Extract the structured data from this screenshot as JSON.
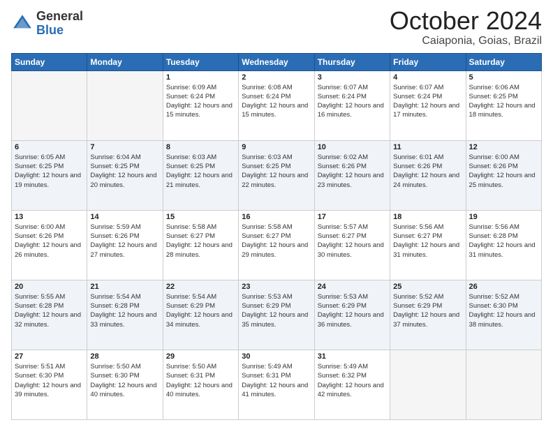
{
  "header": {
    "logo_general": "General",
    "logo_blue": "Blue",
    "month_title": "October 2024",
    "location": "Caiaponia, Goias, Brazil"
  },
  "weekdays": [
    "Sunday",
    "Monday",
    "Tuesday",
    "Wednesday",
    "Thursday",
    "Friday",
    "Saturday"
  ],
  "weeks": [
    [
      {
        "day": "",
        "info": ""
      },
      {
        "day": "",
        "info": ""
      },
      {
        "day": "1",
        "info": "Sunrise: 6:09 AM\nSunset: 6:24 PM\nDaylight: 12 hours and 15 minutes."
      },
      {
        "day": "2",
        "info": "Sunrise: 6:08 AM\nSunset: 6:24 PM\nDaylight: 12 hours and 15 minutes."
      },
      {
        "day": "3",
        "info": "Sunrise: 6:07 AM\nSunset: 6:24 PM\nDaylight: 12 hours and 16 minutes."
      },
      {
        "day": "4",
        "info": "Sunrise: 6:07 AM\nSunset: 6:24 PM\nDaylight: 12 hours and 17 minutes."
      },
      {
        "day": "5",
        "info": "Sunrise: 6:06 AM\nSunset: 6:25 PM\nDaylight: 12 hours and 18 minutes."
      }
    ],
    [
      {
        "day": "6",
        "info": "Sunrise: 6:05 AM\nSunset: 6:25 PM\nDaylight: 12 hours and 19 minutes."
      },
      {
        "day": "7",
        "info": "Sunrise: 6:04 AM\nSunset: 6:25 PM\nDaylight: 12 hours and 20 minutes."
      },
      {
        "day": "8",
        "info": "Sunrise: 6:03 AM\nSunset: 6:25 PM\nDaylight: 12 hours and 21 minutes."
      },
      {
        "day": "9",
        "info": "Sunrise: 6:03 AM\nSunset: 6:25 PM\nDaylight: 12 hours and 22 minutes."
      },
      {
        "day": "10",
        "info": "Sunrise: 6:02 AM\nSunset: 6:26 PM\nDaylight: 12 hours and 23 minutes."
      },
      {
        "day": "11",
        "info": "Sunrise: 6:01 AM\nSunset: 6:26 PM\nDaylight: 12 hours and 24 minutes."
      },
      {
        "day": "12",
        "info": "Sunrise: 6:00 AM\nSunset: 6:26 PM\nDaylight: 12 hours and 25 minutes."
      }
    ],
    [
      {
        "day": "13",
        "info": "Sunrise: 6:00 AM\nSunset: 6:26 PM\nDaylight: 12 hours and 26 minutes."
      },
      {
        "day": "14",
        "info": "Sunrise: 5:59 AM\nSunset: 6:26 PM\nDaylight: 12 hours and 27 minutes."
      },
      {
        "day": "15",
        "info": "Sunrise: 5:58 AM\nSunset: 6:27 PM\nDaylight: 12 hours and 28 minutes."
      },
      {
        "day": "16",
        "info": "Sunrise: 5:58 AM\nSunset: 6:27 PM\nDaylight: 12 hours and 29 minutes."
      },
      {
        "day": "17",
        "info": "Sunrise: 5:57 AM\nSunset: 6:27 PM\nDaylight: 12 hours and 30 minutes."
      },
      {
        "day": "18",
        "info": "Sunrise: 5:56 AM\nSunset: 6:27 PM\nDaylight: 12 hours and 31 minutes."
      },
      {
        "day": "19",
        "info": "Sunrise: 5:56 AM\nSunset: 6:28 PM\nDaylight: 12 hours and 31 minutes."
      }
    ],
    [
      {
        "day": "20",
        "info": "Sunrise: 5:55 AM\nSunset: 6:28 PM\nDaylight: 12 hours and 32 minutes."
      },
      {
        "day": "21",
        "info": "Sunrise: 5:54 AM\nSunset: 6:28 PM\nDaylight: 12 hours and 33 minutes."
      },
      {
        "day": "22",
        "info": "Sunrise: 5:54 AM\nSunset: 6:29 PM\nDaylight: 12 hours and 34 minutes."
      },
      {
        "day": "23",
        "info": "Sunrise: 5:53 AM\nSunset: 6:29 PM\nDaylight: 12 hours and 35 minutes."
      },
      {
        "day": "24",
        "info": "Sunrise: 5:53 AM\nSunset: 6:29 PM\nDaylight: 12 hours and 36 minutes."
      },
      {
        "day": "25",
        "info": "Sunrise: 5:52 AM\nSunset: 6:29 PM\nDaylight: 12 hours and 37 minutes."
      },
      {
        "day": "26",
        "info": "Sunrise: 5:52 AM\nSunset: 6:30 PM\nDaylight: 12 hours and 38 minutes."
      }
    ],
    [
      {
        "day": "27",
        "info": "Sunrise: 5:51 AM\nSunset: 6:30 PM\nDaylight: 12 hours and 39 minutes."
      },
      {
        "day": "28",
        "info": "Sunrise: 5:50 AM\nSunset: 6:30 PM\nDaylight: 12 hours and 40 minutes."
      },
      {
        "day": "29",
        "info": "Sunrise: 5:50 AM\nSunset: 6:31 PM\nDaylight: 12 hours and 40 minutes."
      },
      {
        "day": "30",
        "info": "Sunrise: 5:49 AM\nSunset: 6:31 PM\nDaylight: 12 hours and 41 minutes."
      },
      {
        "day": "31",
        "info": "Sunrise: 5:49 AM\nSunset: 6:32 PM\nDaylight: 12 hours and 42 minutes."
      },
      {
        "day": "",
        "info": ""
      },
      {
        "day": "",
        "info": ""
      }
    ]
  ]
}
